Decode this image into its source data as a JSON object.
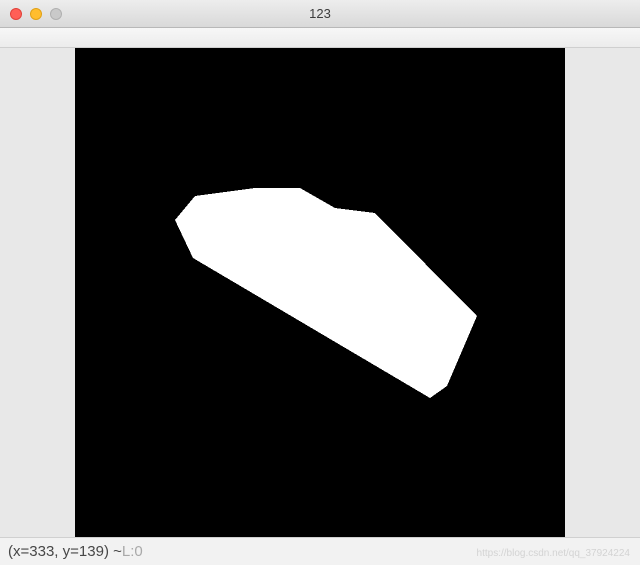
{
  "window": {
    "title": "123"
  },
  "status": {
    "coord_prefix": "(x=",
    "coord_x": "333",
    "coord_mid": ", y=",
    "coord_y": "139",
    "coord_suffix": ") ~ ",
    "pixel_label": "L:",
    "pixel_value": "0"
  },
  "watermark": "https://blog.csdn.net/qq_37924224"
}
